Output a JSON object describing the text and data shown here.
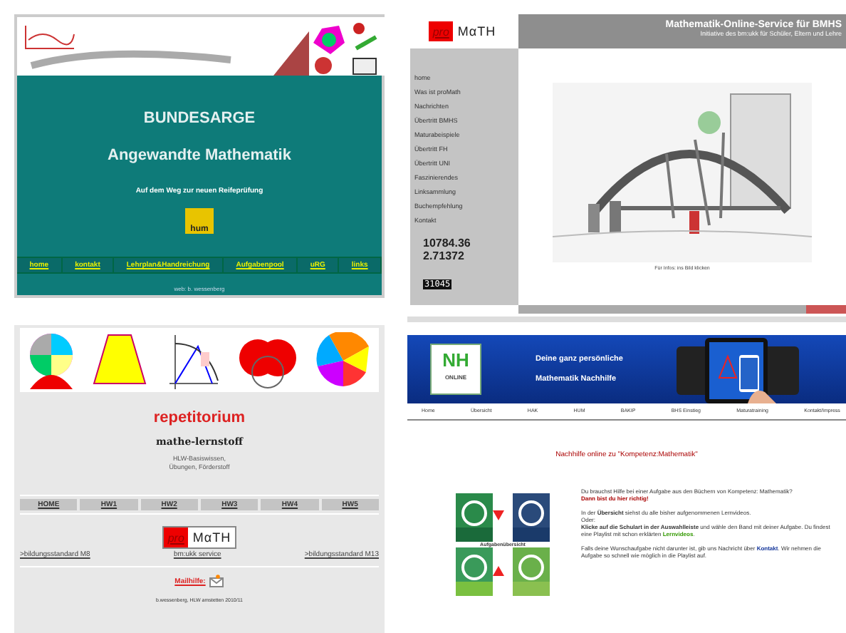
{
  "bundesarge": {
    "title": "BUNDESARGE",
    "subtitle": "Angewandte Mathematik",
    "tagline": "Auf dem Weg zur neuen Reifeprüfung",
    "logo_text": "hum",
    "nav": [
      "home",
      "kontakt",
      "Lehrplan&Handreichung",
      "Aufgabenpool",
      "uRG",
      "links"
    ],
    "footer": "web: b. wessenberg"
  },
  "promath": {
    "logo": {
      "pro": "pro",
      "math": "MαTH"
    },
    "title": "Mathematik-Online-Service für BMHS",
    "subtitle": "Initiative des bm:ukk für Schüler, Eltern und Lehre",
    "sidebar": [
      "home",
      "Was ist proMath",
      "Nachrichten",
      "Übertritt BMHS",
      "Maturabeispiele",
      "Übertritt FH",
      "Übertritt UNI",
      "Faszinierendes",
      "Linksammlung",
      "Buchempfehlung",
      "Kontakt"
    ],
    "numbers": [
      "10784.36",
      "2.71372"
    ],
    "counter": "31045",
    "caption": "Für Infos: ins Bild klicken"
  },
  "repetitorium": {
    "title": "repetitorium",
    "subtitle": "mathe-lernstoff",
    "description": [
      "HLW-Basiswissen,",
      "Übungen, Förderstoff"
    ],
    "nav": [
      "HOME",
      "HW1",
      "HW2",
      "HW3",
      "HW4",
      "HW5"
    ],
    "logo": {
      "pro": "pro",
      "math": "MαTH"
    },
    "links": [
      ">bildungsstandard M8",
      "bm:ukk service",
      ">bildungsstandard M13"
    ],
    "mail": "Mailhilfe:",
    "footer": "b.wessenberg, HLW amstetten 2010/11"
  },
  "nachhilfe": {
    "logo_text": "NH",
    "logo_sub": "ONLINE",
    "headline": [
      "Deine ganz persönliche",
      "Mathematik Nachhilfe"
    ],
    "nav": [
      "Home",
      "Übersicht",
      "HAK",
      "HUM",
      "BAKIP",
      "BHS Einstieg",
      "Maturatraining",
      "Kontakt/Impress"
    ],
    "heading": "Nachhilfe online zu \"Kompetenz:Mathematik\"",
    "books_caption": "Aufgabenübersicht",
    "intro": "Du brauchst Hilfe bei einer Aufgabe aus den Büchern von Kompetenz: Mathematik?",
    "highlight": "Dann bist du hier richtig!",
    "overview": "In der **Übersicht** siehst du alle bisher aufgenommenen Lernvideos.",
    "or": "Oder:",
    "instruction": {
      "text": "**Klicke auf die Schulart in der Auswahlleiste** und wähle den Band mit deiner Aufgabe. Du findest eine Playlist mit schon erklärten ",
      "link": "Lernvideos",
      "after": "."
    },
    "contact": {
      "text": "Falls deine Wunschaufgabe  nicht darunter ist, gib uns Nachricht über ",
      "link": "Kontakt",
      "after": ". Wir nehmen die Aufgabe so schnell wie möglich in die Playlist auf."
    }
  }
}
